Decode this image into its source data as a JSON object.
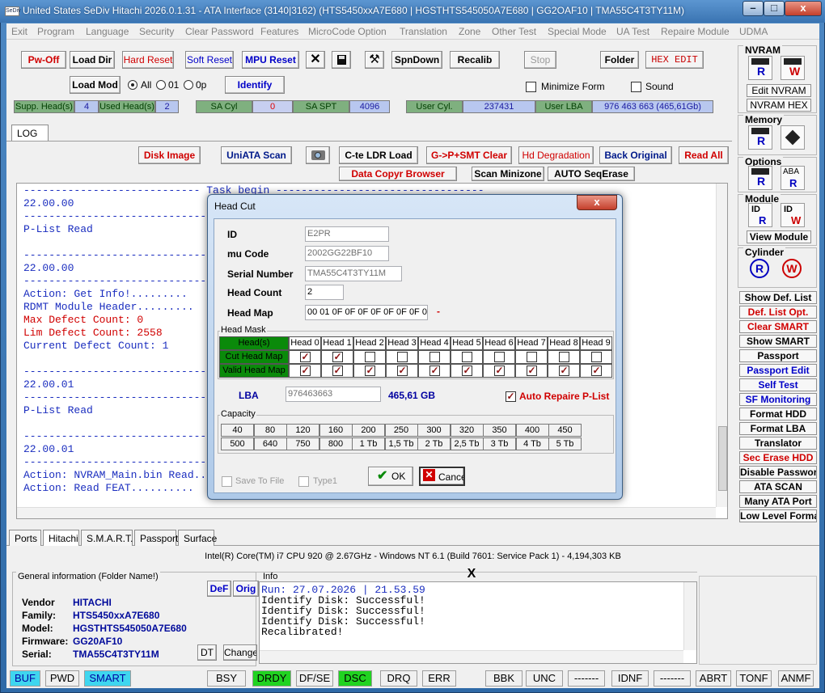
{
  "window": {
    "title": "United States  SeDiv Hitachi  2026.0.1.31 - ATA Interface  (3140|3162)  (HTS5450xxA7E680 | HGSTHTS545050A7E680 | GG2OAF10 | TMA55C4T3TY11M)",
    "minimize": "–",
    "maximize": "□",
    "close": "x",
    "app_icon": "SeDiv"
  },
  "menu": [
    "Exit",
    "Program",
    "Language",
    "Security",
    "Clear Password",
    "Features",
    "MicroCode Option",
    "Translation",
    "Zone",
    "Other Test",
    "Special Mode",
    "UA Test",
    "Repaire Module",
    "UDMA"
  ],
  "toolbar": {
    "pwoff": "Pw-Off",
    "loaddir": "Load Dir",
    "hardreset": "Hard Reset",
    "softreset": "Soft Reset",
    "mpureset": "MPU Reset",
    "spndown": "SpnDown",
    "recalib": "Recalib",
    "stop": "Stop",
    "folder": "Folder",
    "hexedit": "HEX EDIT",
    "loadmod": "Load Mod",
    "opt_all": "All",
    "opt_01": "01",
    "opt_0p": "0p",
    "identify": "Identify",
    "minimize_form": "Minimize Form",
    "sound": "Sound"
  },
  "info_row": {
    "supp_label": "Supp. Head(s)",
    "supp_val": "4",
    "used_label": "Used Head(s)",
    "used_val": "2",
    "sacyl_label": "SA Cyl",
    "sacyl_val": "0",
    "saspt_label": "SA SPT",
    "saspt_val": "4096",
    "usercyl_label": "User Cyl.",
    "usercyl_val": "237431",
    "userlba_label": "User LBA",
    "userlba_val": "976 463 663  (465,61Gb)"
  },
  "log_tab": "LOG",
  "actions": {
    "diskimage": "Disk Image",
    "uniata": "UniATA Scan",
    "cteldr": "C-te LDR Load",
    "gpsmt": "G->P+SMT Clear",
    "hddeg": "Hd Degradation",
    "backorig": "Back Original",
    "readall": "Read All",
    "datacopy": "Data Copyr Browser",
    "scanmin": "Scan Minizone",
    "autoseq": "AUTO SeqErase"
  },
  "log_lines": [
    {
      "t": "---------------------------- Task begin ---------------------------------",
      "c": "#1a2dbf"
    },
    {
      "t": "22.00.00",
      "c": "#1a2dbf"
    },
    {
      "t": "---------------------------------------------------------------",
      "c": "#1a2dbf"
    },
    {
      "t": "P-List Read",
      "c": "#1a2dbf"
    },
    {
      "t": "",
      "c": "#1a2dbf"
    },
    {
      "t": "---------------------------------------------------------------",
      "c": "#1a2dbf"
    },
    {
      "t": "22.00.00",
      "c": "#1a2dbf"
    },
    {
      "t": "---------------------------------------------------------------",
      "c": "#1a2dbf"
    },
    {
      "t": "Action: Get Info!.........",
      "c": "#1a2dbf"
    },
    {
      "t": "RDMT Module Header.........",
      "c": "#1a2dbf"
    },
    {
      "t": "Max Defect Count: 0",
      "c": "#d00000"
    },
    {
      "t": "Lim Defect Count: 2558",
      "c": "#d00000"
    },
    {
      "t": "Current Defect Count: 1",
      "c": "#1a2dbf"
    },
    {
      "t": "",
      "c": "#1a2dbf"
    },
    {
      "t": "---------------------------------------------------------------",
      "c": "#1a2dbf"
    },
    {
      "t": "22.00.01",
      "c": "#1a2dbf"
    },
    {
      "t": "---------------------------------------------------------------",
      "c": "#1a2dbf"
    },
    {
      "t": "P-List Read",
      "c": "#1a2dbf"
    },
    {
      "t": "",
      "c": "#1a2dbf"
    },
    {
      "t": "---------------------------------------------------------------",
      "c": "#1a2dbf"
    },
    {
      "t": "22.00.01",
      "c": "#1a2dbf"
    },
    {
      "t": "---------------------------------------------------------------",
      "c": "#1a2dbf"
    },
    {
      "t": "Action: NVRAM_Main.bin Read...",
      "c": "#1a2dbf"
    },
    {
      "t": "Action: Read FEAT..........",
      "c": "#1a2dbf"
    }
  ],
  "dialog": {
    "title": "Head Cut",
    "close": "x",
    "id_label": "ID",
    "id_val": "E2PR",
    "mucode_label": "mu Code",
    "mucode_val": "2002GG22BF10",
    "serial_label": "Serial Number",
    "serial_val": "TMA55C4T3TY11M",
    "headcount_label": "Head Count",
    "headcount_val": "2",
    "headmap_label": "Head Map",
    "headmap_val": "00 01 0F 0F 0F 0F 0F 0F 0F 0F",
    "headmap_dash": "-",
    "headmask_title": "Head Mask",
    "heads_label": "Head(s)",
    "cut_label": "Cut Head Map",
    "valid_label": "Valid Head Map",
    "heads": [
      "Head 0",
      "Head 1",
      "Head 2",
      "Head 3",
      "Head 4",
      "Head 5",
      "Head 6",
      "Head 7",
      "Head 8",
      "Head 9"
    ],
    "cut": [
      true,
      true,
      false,
      false,
      false,
      false,
      false,
      false,
      false,
      false
    ],
    "valid": [
      true,
      true,
      true,
      true,
      true,
      true,
      true,
      true,
      true,
      true
    ],
    "lba_label": "LBA",
    "lba_val": "976463663",
    "lba_size": "465,61 GB",
    "auto_repair": "Auto Repaire P-List",
    "capacity_title": "Capacity",
    "cap_row1": [
      "40",
      "80",
      "120",
      "160",
      "200",
      "250",
      "300",
      "320",
      "350",
      "400",
      "450"
    ],
    "cap_row2": [
      "500",
      "640",
      "750",
      "800",
      "1 Tb",
      "1,5 Tb",
      "2 Tb",
      "2,5 Tb",
      "3 Tb",
      "4 Tb",
      "5 Tb"
    ],
    "save_to_file": "Save To File",
    "type1": "Type1",
    "ok": "OK",
    "cancel": "Cancel"
  },
  "bottom_tabs": [
    "Ports",
    "Hitachi",
    "S.M.A.R.T.",
    "Passport",
    "Surface"
  ],
  "cpu_info": "Intel(R) Core(TM) i7 CPU 920  @ 2.67GHz - Windows NT 6.1 (Build 7601: Service Pack 1) -  4,194,303 KB",
  "general": {
    "title": "General information (Folder Name!)",
    "def": "DeF",
    "orig": "Orig",
    "dt": "DT",
    "change": "Change",
    "rows": [
      {
        "k": "Vendor",
        "v": "HITACHI"
      },
      {
        "k": "Family:",
        "v": "HTS5450xxA7E680"
      },
      {
        "k": "Model:",
        "v": "HGSTHTS545050A7E680"
      },
      {
        "k": "Firmware:",
        "v": "GG20AF10"
      },
      {
        "k": "Serial:",
        "v": "TMA55C4T3TY11M"
      }
    ]
  },
  "info_panel": {
    "title": "Info",
    "close": "X",
    "lines": [
      "Run: 27.07.2026 | 21.53.59",
      "Identify Disk: Successful!",
      "Identify Disk: Successful!",
      "Identify Disk: Successful!",
      "Recalibrated!"
    ]
  },
  "status": [
    {
      "t": "BUF",
      "bg": "#3fd6ef",
      "c": "#0000a0"
    },
    {
      "t": "PWD",
      "bg": "#f0f0f0",
      "c": "#000"
    },
    {
      "t": "SMART",
      "bg": "#3fd6ef",
      "c": "#0000a0"
    },
    {
      "t": "BSY",
      "bg": "#f0f0f0",
      "c": "#000"
    },
    {
      "t": "DRDY",
      "bg": "#21d321",
      "c": "#000"
    },
    {
      "t": "DF/SE",
      "bg": "#f0f0f0",
      "c": "#000"
    },
    {
      "t": "DSC",
      "bg": "#21d321",
      "c": "#000"
    },
    {
      "t": "DRQ",
      "bg": "#f0f0f0",
      "c": "#000"
    },
    {
      "t": "ERR",
      "bg": "#f0f0f0",
      "c": "#000"
    },
    {
      "t": "BBK",
      "bg": "#f0f0f0",
      "c": "#000"
    },
    {
      "t": "UNC",
      "bg": "#f0f0f0",
      "c": "#000"
    },
    {
      "t": "-------",
      "bg": "#f0f0f0",
      "c": "#000"
    },
    {
      "t": "IDNF",
      "bg": "#f0f0f0",
      "c": "#000"
    },
    {
      "t": "-------",
      "bg": "#f0f0f0",
      "c": "#000"
    },
    {
      "t": "ABRT",
      "bg": "#f0f0f0",
      "c": "#000"
    },
    {
      "t": "TONF",
      "bg": "#f0f0f0",
      "c": "#000"
    },
    {
      "t": "ANMF",
      "bg": "#f0f0f0",
      "c": "#000"
    }
  ],
  "sidebar": {
    "nvram": "NVRAM",
    "edit_nvram": "Edit NVRAM",
    "nvram_hex": "NVRAM HEX",
    "memory": "Memory",
    "options": "Options",
    "module": "Module",
    "view_module": "View Module",
    "cylinder": "Cylinder",
    "r": "R",
    "w": "W",
    "id": "ID",
    "aba": "ABA",
    "buttons": [
      {
        "t": "Show Def. List",
        "c": "#000"
      },
      {
        "t": "Def. List Opt.",
        "c": "#d00000"
      },
      {
        "t": "Clear SMART",
        "c": "#d00000"
      },
      {
        "t": "Show SMART",
        "c": "#000"
      },
      {
        "t": "Passport",
        "c": "#000"
      },
      {
        "t": "Passport Edit",
        "c": "#0000c8"
      },
      {
        "t": "Self Test",
        "c": "#0000c8"
      },
      {
        "t": "SF Monitoring",
        "c": "#0000c8"
      },
      {
        "t": "Format HDD",
        "c": "#000"
      },
      {
        "t": "Format LBA",
        "c": "#000"
      },
      {
        "t": "Translator",
        "c": "#000"
      },
      {
        "t": "Sec Erase HDD",
        "c": "#d00000"
      },
      {
        "t": "Disable Password",
        "c": "#000"
      },
      {
        "t": "ATA SCAN",
        "c": "#000"
      },
      {
        "t": "Many ATA Port",
        "c": "#000"
      },
      {
        "t": "Low Level Format",
        "c": "#000"
      }
    ]
  }
}
